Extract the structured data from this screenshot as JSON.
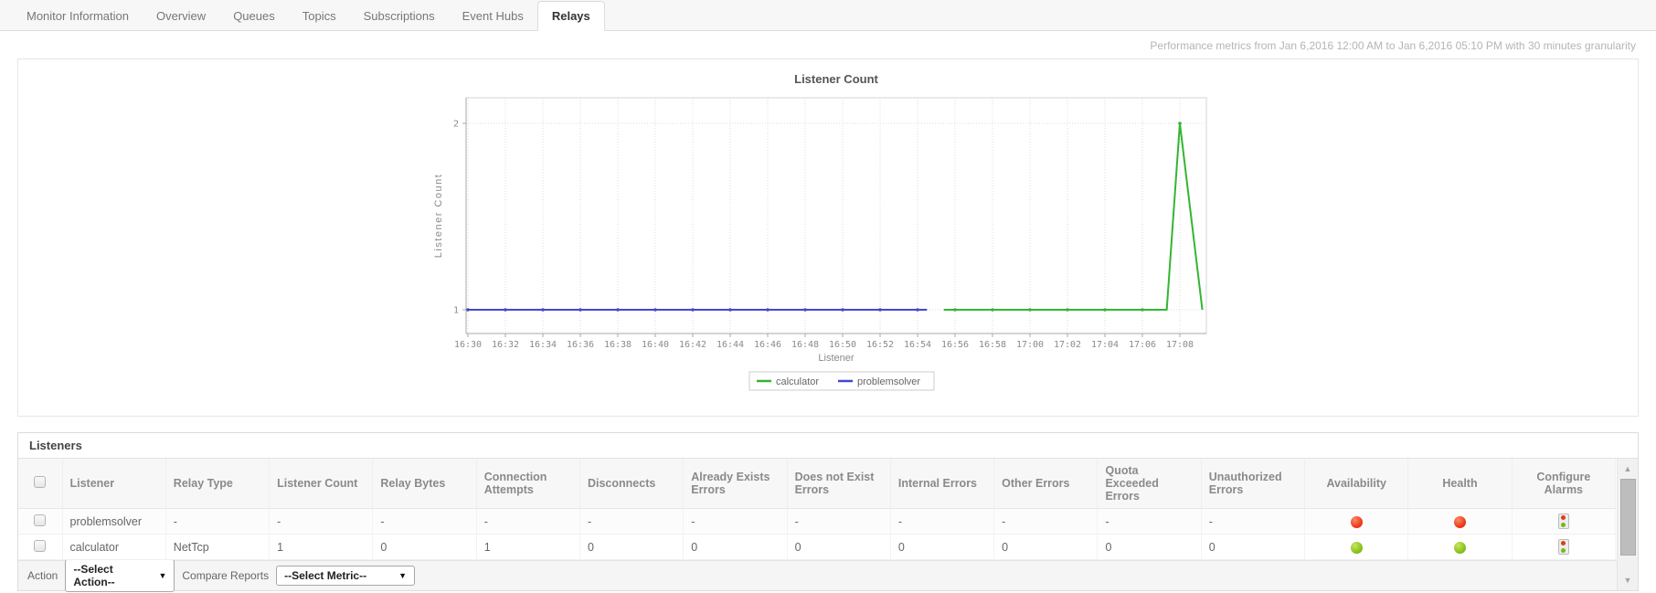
{
  "tabs": {
    "items": [
      {
        "label": "Monitor Information",
        "active": false
      },
      {
        "label": "Overview",
        "active": false
      },
      {
        "label": "Queues",
        "active": false
      },
      {
        "label": "Topics",
        "active": false
      },
      {
        "label": "Subscriptions",
        "active": false
      },
      {
        "label": "Event Hubs",
        "active": false
      },
      {
        "label": "Relays",
        "active": true
      }
    ]
  },
  "header": {
    "metrics_note": "Performance metrics from Jan 6,2016 12:00 AM to Jan 6,2016 05:10 PM with 30 minutes granularity"
  },
  "chart_data": {
    "type": "line",
    "title": "Listener Count",
    "xlabel": "Listener",
    "ylabel": "Listener Count",
    "x_tick_labels": [
      "16:30",
      "16:32",
      "16:34",
      "16:36",
      "16:38",
      "16:40",
      "16:42",
      "16:44",
      "16:46",
      "16:48",
      "16:50",
      "16:52",
      "16:54",
      "16:56",
      "16:58",
      "17:00",
      "17:02",
      "17:04",
      "17:06",
      "17:08"
    ],
    "y_ticks": [
      1,
      2
    ],
    "ylim": [
      0.87,
      2.26
    ],
    "grid": true,
    "legend_position": "bottom",
    "series": [
      {
        "name": "calculator",
        "color": "#33b533",
        "points": [
          [
            25.4,
            1
          ],
          [
            26,
            1
          ],
          [
            28,
            1
          ],
          [
            30,
            1
          ],
          [
            32,
            1
          ],
          [
            34,
            1
          ],
          [
            36,
            1
          ],
          [
            37.3,
            1
          ],
          [
            38,
            2
          ],
          [
            39.2,
            1
          ]
        ]
      },
      {
        "name": "problemsolver",
        "color": "#4646cc",
        "points": [
          [
            0,
            1
          ],
          [
            2,
            1
          ],
          [
            4,
            1
          ],
          [
            6,
            1
          ],
          [
            8,
            1
          ],
          [
            10,
            1
          ],
          [
            12,
            1
          ],
          [
            14,
            1
          ],
          [
            16,
            1
          ],
          [
            18,
            1
          ],
          [
            20,
            1
          ],
          [
            22,
            1
          ],
          [
            24,
            1
          ],
          [
            24.5,
            1
          ]
        ]
      }
    ]
  },
  "listeners": {
    "title": "Listeners",
    "columns": [
      "Listener",
      "Relay Type",
      "Listener Count",
      "Relay Bytes",
      "Connection Attempts",
      "Disconnects",
      "Already Exists Errors",
      "Does not Exist Errors",
      "Internal Errors",
      "Other Errors",
      "Quota Exceeded Errors",
      "Unauthorized Errors",
      "Availability",
      "Health",
      "Configure Alarms"
    ],
    "rows": [
      {
        "cells": [
          "problemsolver",
          "-",
          "-",
          "-",
          "-",
          "-",
          "-",
          "-",
          "-",
          "-",
          "-",
          "-"
        ],
        "availability": "down",
        "health": "down"
      },
      {
        "cells": [
          "calculator",
          "NetTcp",
          "1",
          "0",
          "1",
          "0",
          "0",
          "0",
          "0",
          "0",
          "0",
          "0"
        ],
        "availability": "up",
        "health": "up"
      }
    ],
    "action_label": "Action",
    "action_select": "--Select Action--",
    "compare_label": "Compare Reports",
    "compare_select": "--Select Metric--"
  },
  "icons": {
    "scroll_up": "▲",
    "scroll_down": "▼",
    "select_caret": "▼"
  },
  "colors": {
    "status_up": "#8bc11e",
    "status_down": "#ee3c1c",
    "series_calculator": "#33b533",
    "series_problemsolver": "#4646cc"
  }
}
